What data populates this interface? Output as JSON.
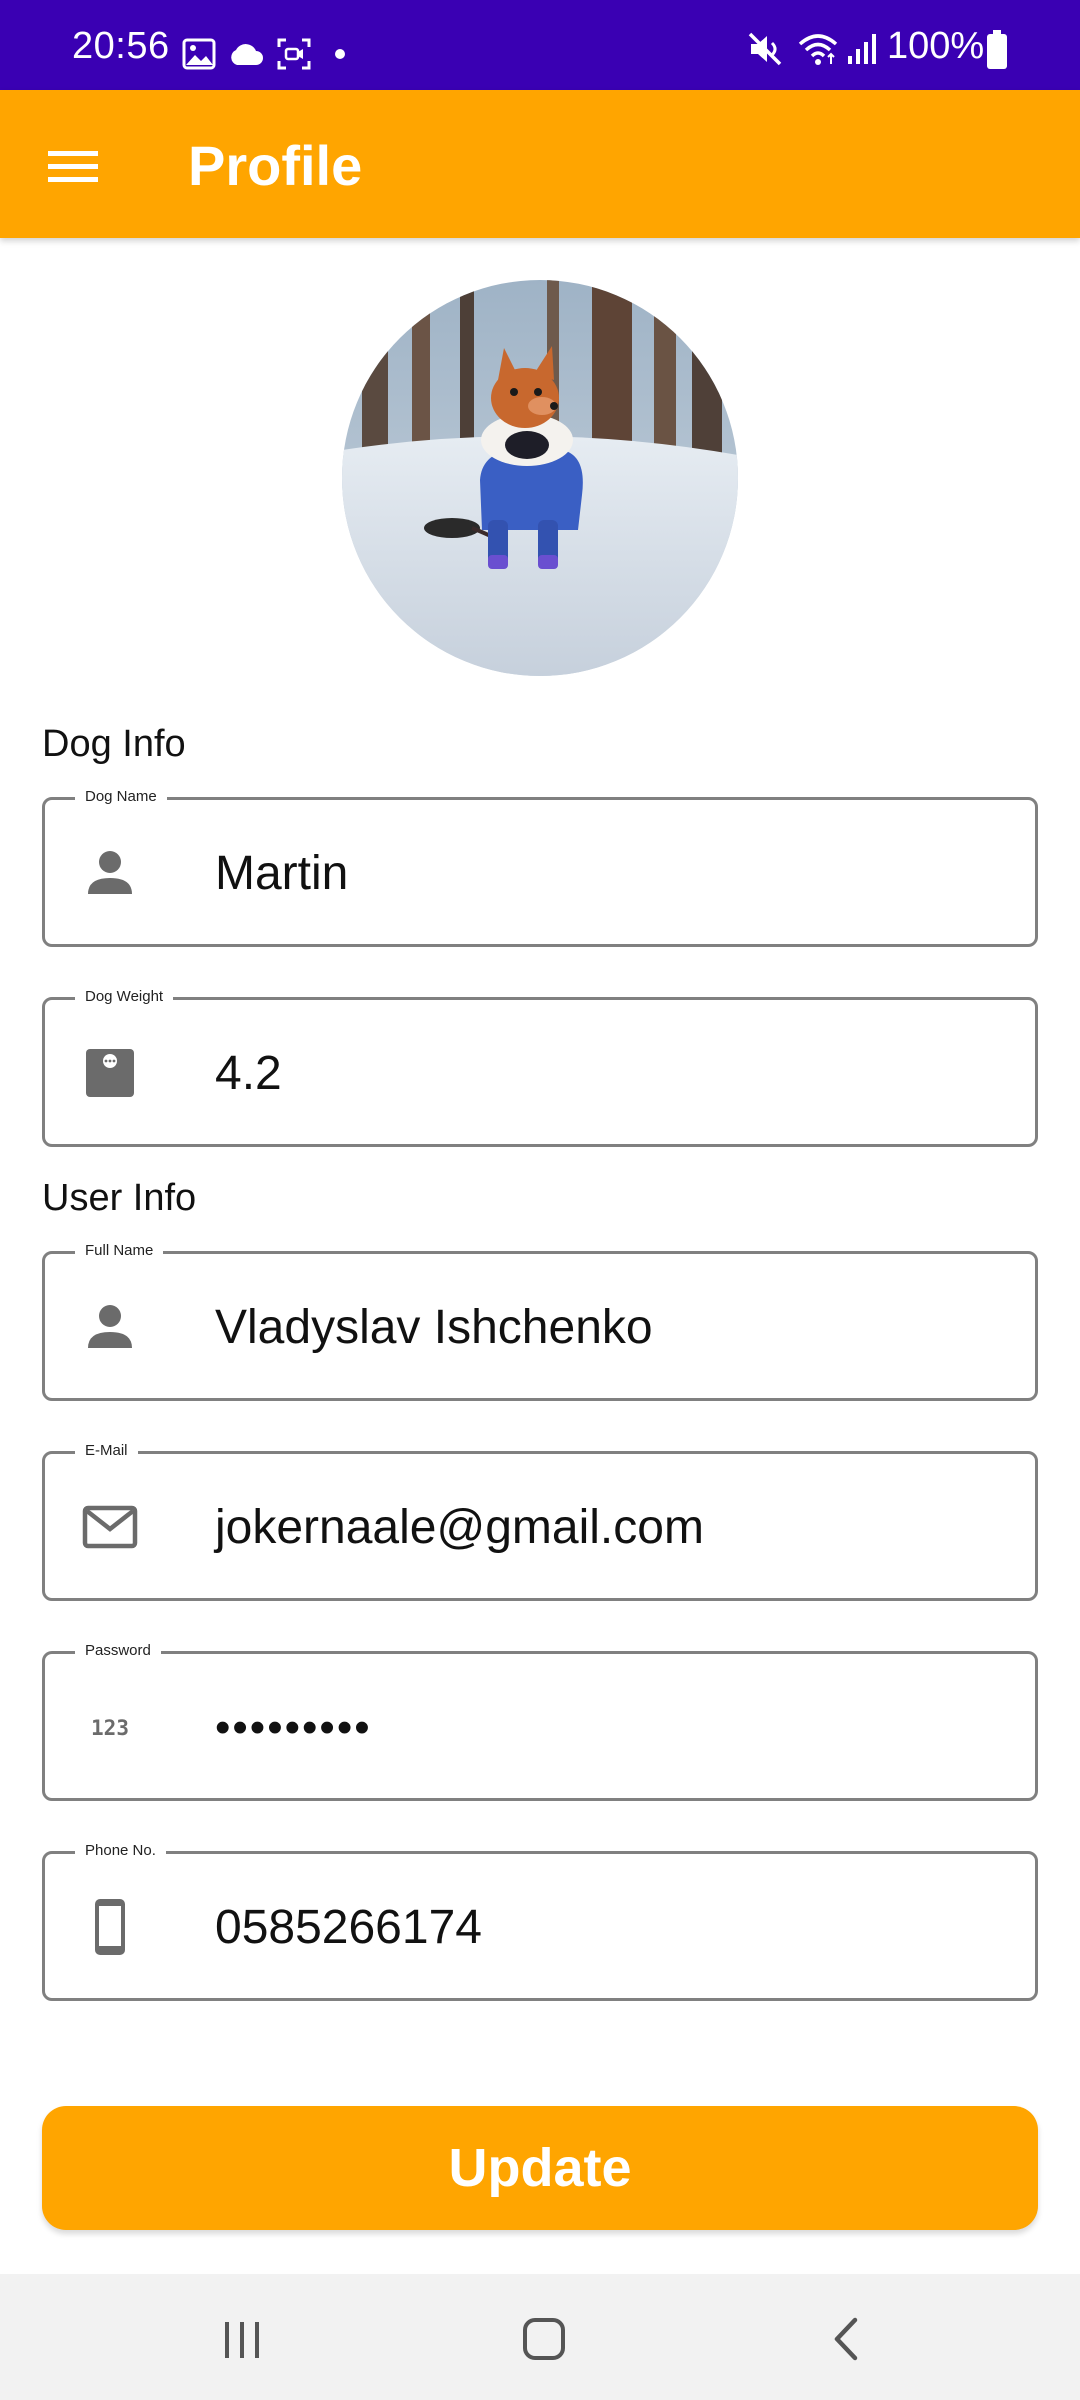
{
  "status_bar": {
    "time": "20:56",
    "battery": "100%",
    "background": "#3a00b3",
    "left_icons": [
      "gallery-icon",
      "cloud-icon",
      "screen-record-icon",
      "dot-icon"
    ],
    "right_icons": [
      "mute-icon",
      "wifi-icon",
      "signal-icon",
      "battery-icon"
    ]
  },
  "app_bar": {
    "title": "Profile",
    "background": "#ffa500",
    "menu_icon": "hamburger-menu-icon"
  },
  "avatar": {
    "icon": "dog-photo-avatar"
  },
  "dog_info": {
    "heading": "Dog Info",
    "fields": [
      {
        "label": "Dog Name",
        "value": "Martin",
        "icon": "person-icon"
      },
      {
        "label": "Dog Weight",
        "value": "4.2",
        "icon": "scale-icon"
      }
    ]
  },
  "user_info": {
    "heading": "User Info",
    "fields": [
      {
        "label": "Full Name",
        "value": "Vladyslav Ishchenko",
        "icon": "person-icon"
      },
      {
        "label": "E-Mail",
        "value": "jokernaale@gmail.com",
        "icon": "mail-icon"
      },
      {
        "label": "Password",
        "value": "•••••••••",
        "icon": "numeric-123-icon"
      },
      {
        "label": "Phone No.",
        "value": "0585266174",
        "icon": "phone-icon"
      }
    ]
  },
  "update_button": {
    "label": "Update",
    "background": "#ffa500"
  },
  "nav_bar": {
    "icons": [
      "recent-apps-icon",
      "home-icon",
      "back-icon"
    ]
  }
}
